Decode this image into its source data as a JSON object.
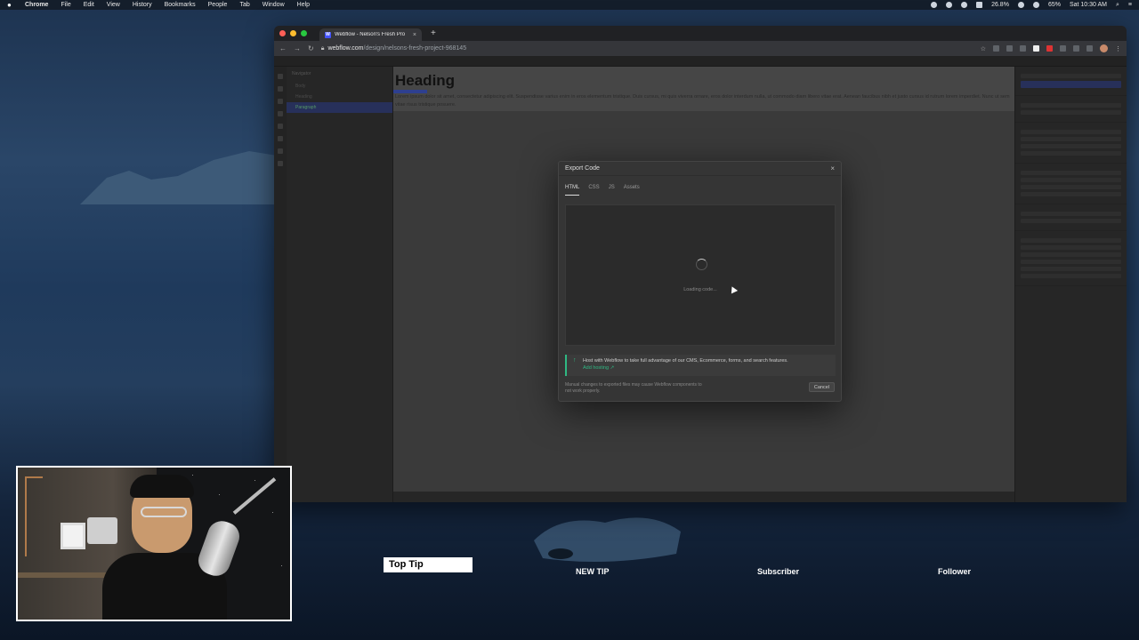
{
  "menubar": {
    "app": "Chrome",
    "items": [
      "File",
      "Edit",
      "View",
      "History",
      "Bookmarks",
      "People",
      "Tab",
      "Window",
      "Help"
    ],
    "cpu": "26.8%",
    "battery": "65%",
    "clock": "Sat 10:30 AM"
  },
  "browser": {
    "tab_title": "Webflow - Nelson's Fresh Pro",
    "favicon_letter": "W",
    "url_host": "webflow.com",
    "url_path": "/design/nelsons-fresh-project-968145"
  },
  "canvas": {
    "heading": "Heading",
    "paragraph": "Lorem ipsum dolor sit amet, consectetur adipiscing elit. Suspendisse varius enim in eros elementum tristique. Duis cursus, mi quis viverra ornare, eros dolor interdum nulla, ut commodo diam libero vitae erat. Aenean faucibus nibh et justo cursus id rutrum lorem imperdiet. Nunc ut sem vitae risus tristique posuere."
  },
  "navigator": {
    "title": "Navigator",
    "rows": [
      "Body",
      "Heading",
      "Paragraph"
    ]
  },
  "modal": {
    "title": "Export Code",
    "tabs": [
      "HTML",
      "CSS",
      "JS",
      "Assets"
    ],
    "active_tab": "HTML",
    "loading_text": "Loading code...",
    "promo_text": "Host with Webflow to take full advantage of our CMS, Ecommerce, forms, and search features.",
    "promo_link": "Add hosting",
    "note": "Manual changes to exported files may cause Webflow components to not work properly.",
    "cancel_label": "Cancel",
    "accent": "#2fb883"
  },
  "overlay": {
    "top_tip": "Top Tip",
    "new_tip": "NEW TIP",
    "subscriber": "Subscriber",
    "follower": "Follower"
  }
}
